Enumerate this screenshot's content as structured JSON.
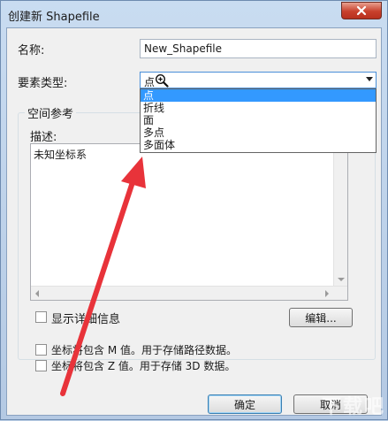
{
  "window": {
    "title": "创建新 Shapefile"
  },
  "form": {
    "name_label": "名称:",
    "name_value": "New_Shapefile",
    "feature_type_label": "要素类型:",
    "feature_type_value": "点",
    "feature_type_options": [
      "点",
      "折线",
      "面",
      "多点",
      "多面体"
    ]
  },
  "spatial_ref": {
    "group_title": "空间参考",
    "description_label": "描述:",
    "description_value": "未知坐标系",
    "show_details_label": "显示详细信息",
    "edit_button": "编辑..."
  },
  "options": {
    "m_values_label": "坐标将包含 M 值。用于存储路径数据。",
    "z_values_label": "坐标将包含 Z 值。用于存储 3D 数据。"
  },
  "buttons": {
    "ok": "确定",
    "cancel": "取消"
  },
  "colors": {
    "selection": "#3399ff",
    "arrow": "#e8333a",
    "close_button": "#c8402c"
  },
  "icons": {
    "close": "close-icon",
    "cursor": "magnifier-cursor-icon"
  }
}
